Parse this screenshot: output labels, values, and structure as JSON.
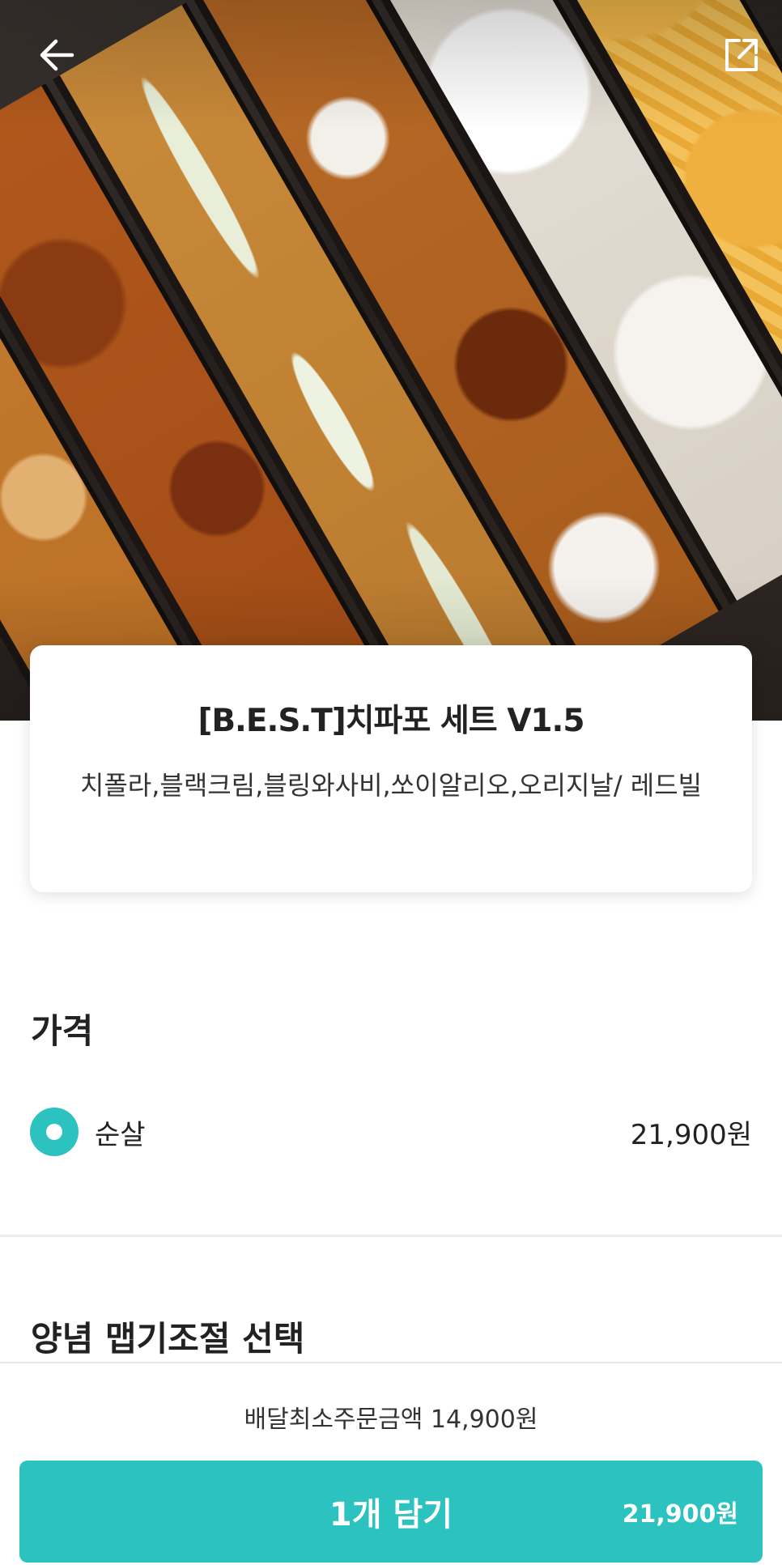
{
  "header": {
    "back_icon": "arrow-left-icon",
    "share_icon": "share-external-icon"
  },
  "product": {
    "title": "[B.E.S.T]치파포 세트 V1.5",
    "description": "치폴라,블랙크림,블링와사비,쏘이알리오,오리지날/ 레드빌"
  },
  "price_section": {
    "title": "가격",
    "options": [
      {
        "label": "순살",
        "price": "21,900원",
        "selected": true
      }
    ]
  },
  "spice_section": {
    "title": "양념 맵기조절 선택"
  },
  "footer": {
    "min_order": "배달최소주문금액 14,900원",
    "cart_label": "1개 담기",
    "cart_price": "21,900원"
  },
  "colors": {
    "accent": "#2cc2bf"
  }
}
